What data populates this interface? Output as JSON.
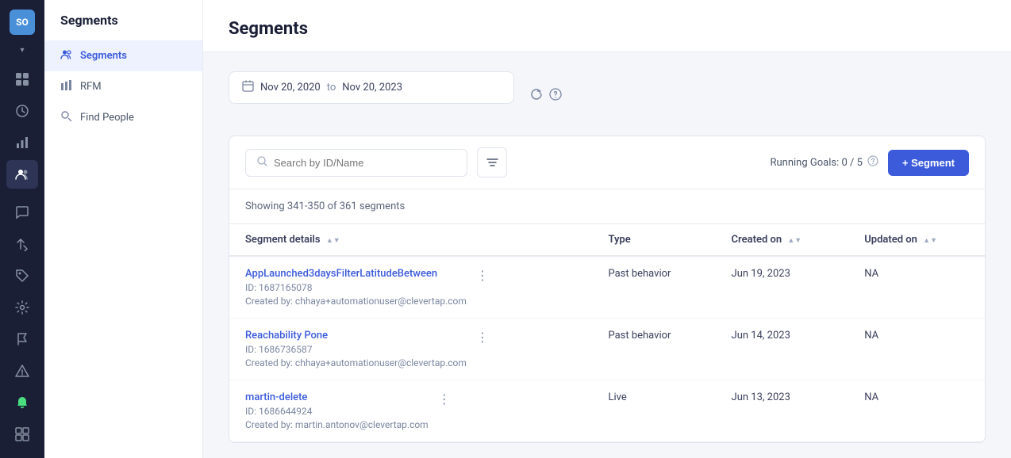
{
  "app": {
    "avatar_label": "SO",
    "avatar_bg": "#4a90d9"
  },
  "sidebar": {
    "title": "Segments",
    "items": [
      {
        "id": "segments",
        "label": "Segments",
        "icon": "👥",
        "active": true
      },
      {
        "id": "rfm",
        "label": "RFM",
        "icon": "⊞",
        "active": false
      },
      {
        "id": "find-people",
        "label": "Find People",
        "icon": "🔍",
        "active": false
      }
    ]
  },
  "main_title": "Segments",
  "date_range": {
    "start": "Nov 20, 2020",
    "to": "to",
    "end": "Nov 20, 2023"
  },
  "toolbar": {
    "search_placeholder": "Search by ID/Name",
    "running_goals_label": "Running Goals: 0 / 5",
    "add_segment_label": "+ Segment"
  },
  "table": {
    "showing_text": "Showing 341-350 of 361 segments",
    "columns": [
      {
        "label": "Segment details",
        "sortable": true
      },
      {
        "label": "Type",
        "sortable": false
      },
      {
        "label": "Created on",
        "sortable": true
      },
      {
        "label": "Updated on",
        "sortable": true
      }
    ],
    "rows": [
      {
        "name": "AppLaunched3daysFilterLatitudeBetween",
        "id": "ID: 1687165078",
        "created_by": "Created by: chhaya+automationuser@clevertap.com",
        "type": "Past behavior",
        "created_on": "Jun 19, 2023",
        "updated_on": "NA"
      },
      {
        "name": "Reachability Pone",
        "id": "ID: 1686736587",
        "created_by": "Created by: chhaya+automationuser@clevertap.com",
        "type": "Past behavior",
        "created_on": "Jun 14, 2023",
        "updated_on": "NA"
      },
      {
        "name": "martin-delete",
        "id": "ID: 1686644924",
        "created_by": "Created by: martin.antonov@clevertap.com",
        "type": "Live",
        "created_on": "Jun 13, 2023",
        "updated_on": "NA"
      }
    ]
  },
  "icons": {
    "dashboard": "⊞",
    "segments_nav": "👥",
    "chart": "📊",
    "funnel": "⬆",
    "tag": "🏷",
    "comment": "💬",
    "arrows": "⇄",
    "cog": "⚙",
    "flag": "🚩",
    "warning": "⚠",
    "bell": "🔔",
    "grid": "⊞"
  }
}
